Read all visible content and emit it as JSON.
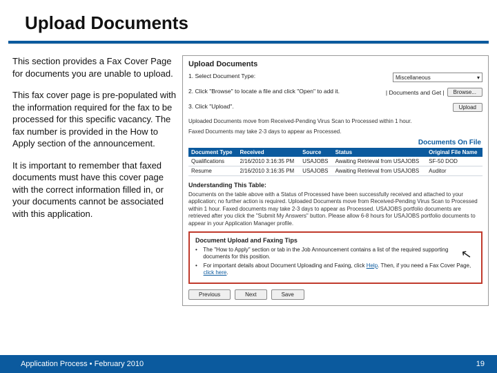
{
  "title": "Upload Documents",
  "left": {
    "p1": "This section provides a Fax Cover Page for documents you are unable to upload.",
    "p2": "This fax cover page is pre-populated with the information required for the fax to be processed for this specific vacancy. The fax number is provided in the How to Apply section of the announcement.",
    "p3": "It is important to remember that faxed documents must have this cover page with the correct information filled in, or your documents cannot be associated with this application."
  },
  "panel": {
    "heading": "Upload Documents",
    "step1": "1. Select Document Type:",
    "selectValue": "Miscellaneous",
    "step2": "2. Click \"Browse\" to locate a file and click \"Open\" to add it.",
    "browse": "Browse...",
    "step3": "3. Click \"Upload\".",
    "upload": "Upload",
    "docsGetLabel": "| Documents and Get |",
    "note1": "Uploaded Documents move from Received-Pending Virus Scan to Processed within 1 hour.",
    "note2": "Faxed Documents may take 2-3 days to appear as Processed.",
    "docsOnFile": "Documents On File",
    "cols": {
      "type": "Document Type",
      "received": "Received",
      "source": "Source",
      "status": "Status",
      "orig": "Original File Name"
    },
    "rows": [
      {
        "type": "Qualifications",
        "received": "2/16/2010 3:16:35 PM",
        "source": "USAJOBS",
        "status": "Awaiting Retrieval from USAJOBS",
        "orig": "SF-50 DOD"
      },
      {
        "type": "Resume",
        "received": "2/16/2010 3:16:35 PM",
        "source": "USAJOBS",
        "status": "Awaiting Retrieval from USAJOBS",
        "orig": "Auditor"
      }
    ],
    "understand": "Understanding This Table:",
    "utext": "Documents on the table above with a Status of Processed have been successfully received and attached to your application; no further action is required. Uploaded Documents move from Received-Pending Virus Scan to Processed within 1 hour. Faxed documents may take 2-3 days to appear as Processed. USAJOBS portfolio documents are retrieved after you click the \"Submit My Answers\" button. Please allow 6-8 hours for USAJOBS portfolio documents to appear in your Application Manager profile.",
    "tipsTitle": "Document Upload and Faxing Tips",
    "tip1": "The \"How to Apply\" section or tab in the Job Announcement contains a list of the required supporting documents for this position.",
    "tip2a": "For important details about Document Uploading and Faxing, click ",
    "tip2link1": "Help",
    "tip2b": ". Then, if you need a Fax Cover Page, ",
    "tip2link2": "click here",
    "prev": "Previous",
    "next": "Next",
    "save": "Save"
  },
  "footer": {
    "left": "Application Process  •  February 2010",
    "page": "19"
  }
}
